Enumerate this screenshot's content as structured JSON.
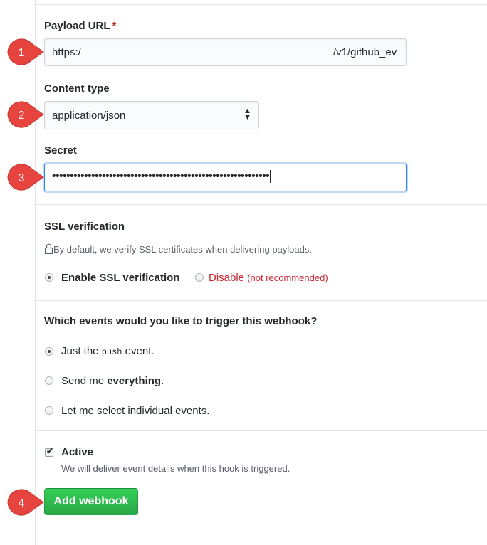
{
  "payload": {
    "label": "Payload URL",
    "required_mark": "*",
    "value_start": "https:/",
    "value_end": "/v1/github_ev"
  },
  "content_type": {
    "label": "Content type",
    "selected": "application/json",
    "arrows_icon": "select-arrows-icon"
  },
  "secret": {
    "label": "Secret",
    "masked_value": "•••••••••••••••••••••••••••••••••••••••••••••••••••••••••••••"
  },
  "ssl": {
    "heading": "SSL verification",
    "note": "By default, we verify SSL certificates when delivering payloads.",
    "enable_label": "Enable SSL verification",
    "disable_label": "Disable",
    "disable_note": "(not recommended)",
    "selected": "enable"
  },
  "events": {
    "heading": "Which events would you like to trigger this webhook?",
    "option1_prefix": "Just the ",
    "option1_code": "push",
    "option1_suffix": " event.",
    "option2_prefix": "Send me ",
    "option2_bold": "everything",
    "option2_suffix": ".",
    "option3": "Let me select individual events.",
    "selected": "push"
  },
  "active": {
    "label": "Active",
    "checked": true,
    "note": "We will deliver event details when this hook is triggered."
  },
  "submit": {
    "label": "Add webhook"
  },
  "markers": [
    "1",
    "2",
    "3",
    "4"
  ],
  "colors": {
    "marker": "#e8443f",
    "primary_button": "#2cbe4e",
    "danger": "#cb2431",
    "focus": "#2188ff"
  }
}
